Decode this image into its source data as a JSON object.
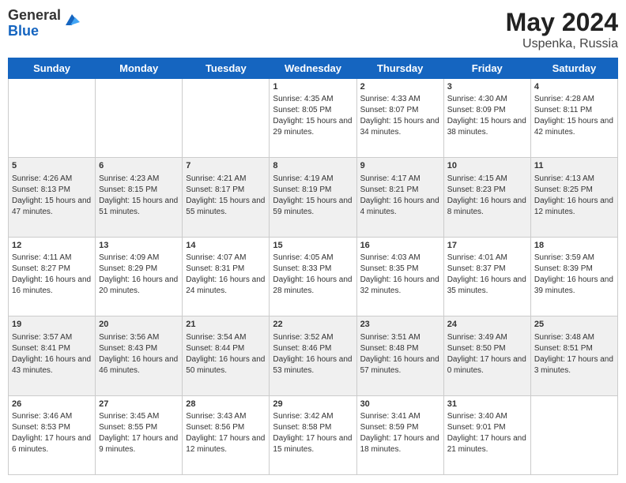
{
  "logo": {
    "general": "General",
    "blue": "Blue"
  },
  "title": {
    "month": "May 2024",
    "location": "Uspenka, Russia"
  },
  "days_of_week": [
    "Sunday",
    "Monday",
    "Tuesday",
    "Wednesday",
    "Thursday",
    "Friday",
    "Saturday"
  ],
  "weeks": [
    [
      {
        "day": "",
        "sunrise": "",
        "sunset": "",
        "daylight": ""
      },
      {
        "day": "",
        "sunrise": "",
        "sunset": "",
        "daylight": ""
      },
      {
        "day": "",
        "sunrise": "",
        "sunset": "",
        "daylight": ""
      },
      {
        "day": "1",
        "sunrise": "Sunrise: 4:35 AM",
        "sunset": "Sunset: 8:05 PM",
        "daylight": "Daylight: 15 hours and 29 minutes."
      },
      {
        "day": "2",
        "sunrise": "Sunrise: 4:33 AM",
        "sunset": "Sunset: 8:07 PM",
        "daylight": "Daylight: 15 hours and 34 minutes."
      },
      {
        "day": "3",
        "sunrise": "Sunrise: 4:30 AM",
        "sunset": "Sunset: 8:09 PM",
        "daylight": "Daylight: 15 hours and 38 minutes."
      },
      {
        "day": "4",
        "sunrise": "Sunrise: 4:28 AM",
        "sunset": "Sunset: 8:11 PM",
        "daylight": "Daylight: 15 hours and 42 minutes."
      }
    ],
    [
      {
        "day": "5",
        "sunrise": "Sunrise: 4:26 AM",
        "sunset": "Sunset: 8:13 PM",
        "daylight": "Daylight: 15 hours and 47 minutes."
      },
      {
        "day": "6",
        "sunrise": "Sunrise: 4:23 AM",
        "sunset": "Sunset: 8:15 PM",
        "daylight": "Daylight: 15 hours and 51 minutes."
      },
      {
        "day": "7",
        "sunrise": "Sunrise: 4:21 AM",
        "sunset": "Sunset: 8:17 PM",
        "daylight": "Daylight: 15 hours and 55 minutes."
      },
      {
        "day": "8",
        "sunrise": "Sunrise: 4:19 AM",
        "sunset": "Sunset: 8:19 PM",
        "daylight": "Daylight: 15 hours and 59 minutes."
      },
      {
        "day": "9",
        "sunrise": "Sunrise: 4:17 AM",
        "sunset": "Sunset: 8:21 PM",
        "daylight": "Daylight: 16 hours and 4 minutes."
      },
      {
        "day": "10",
        "sunrise": "Sunrise: 4:15 AM",
        "sunset": "Sunset: 8:23 PM",
        "daylight": "Daylight: 16 hours and 8 minutes."
      },
      {
        "day": "11",
        "sunrise": "Sunrise: 4:13 AM",
        "sunset": "Sunset: 8:25 PM",
        "daylight": "Daylight: 16 hours and 12 minutes."
      }
    ],
    [
      {
        "day": "12",
        "sunrise": "Sunrise: 4:11 AM",
        "sunset": "Sunset: 8:27 PM",
        "daylight": "Daylight: 16 hours and 16 minutes."
      },
      {
        "day": "13",
        "sunrise": "Sunrise: 4:09 AM",
        "sunset": "Sunset: 8:29 PM",
        "daylight": "Daylight: 16 hours and 20 minutes."
      },
      {
        "day": "14",
        "sunrise": "Sunrise: 4:07 AM",
        "sunset": "Sunset: 8:31 PM",
        "daylight": "Daylight: 16 hours and 24 minutes."
      },
      {
        "day": "15",
        "sunrise": "Sunrise: 4:05 AM",
        "sunset": "Sunset: 8:33 PM",
        "daylight": "Daylight: 16 hours and 28 minutes."
      },
      {
        "day": "16",
        "sunrise": "Sunrise: 4:03 AM",
        "sunset": "Sunset: 8:35 PM",
        "daylight": "Daylight: 16 hours and 32 minutes."
      },
      {
        "day": "17",
        "sunrise": "Sunrise: 4:01 AM",
        "sunset": "Sunset: 8:37 PM",
        "daylight": "Daylight: 16 hours and 35 minutes."
      },
      {
        "day": "18",
        "sunrise": "Sunrise: 3:59 AM",
        "sunset": "Sunset: 8:39 PM",
        "daylight": "Daylight: 16 hours and 39 minutes."
      }
    ],
    [
      {
        "day": "19",
        "sunrise": "Sunrise: 3:57 AM",
        "sunset": "Sunset: 8:41 PM",
        "daylight": "Daylight: 16 hours and 43 minutes."
      },
      {
        "day": "20",
        "sunrise": "Sunrise: 3:56 AM",
        "sunset": "Sunset: 8:43 PM",
        "daylight": "Daylight: 16 hours and 46 minutes."
      },
      {
        "day": "21",
        "sunrise": "Sunrise: 3:54 AM",
        "sunset": "Sunset: 8:44 PM",
        "daylight": "Daylight: 16 hours and 50 minutes."
      },
      {
        "day": "22",
        "sunrise": "Sunrise: 3:52 AM",
        "sunset": "Sunset: 8:46 PM",
        "daylight": "Daylight: 16 hours and 53 minutes."
      },
      {
        "day": "23",
        "sunrise": "Sunrise: 3:51 AM",
        "sunset": "Sunset: 8:48 PM",
        "daylight": "Daylight: 16 hours and 57 minutes."
      },
      {
        "day": "24",
        "sunrise": "Sunrise: 3:49 AM",
        "sunset": "Sunset: 8:50 PM",
        "daylight": "Daylight: 17 hours and 0 minutes."
      },
      {
        "day": "25",
        "sunrise": "Sunrise: 3:48 AM",
        "sunset": "Sunset: 8:51 PM",
        "daylight": "Daylight: 17 hours and 3 minutes."
      }
    ],
    [
      {
        "day": "26",
        "sunrise": "Sunrise: 3:46 AM",
        "sunset": "Sunset: 8:53 PM",
        "daylight": "Daylight: 17 hours and 6 minutes."
      },
      {
        "day": "27",
        "sunrise": "Sunrise: 3:45 AM",
        "sunset": "Sunset: 8:55 PM",
        "daylight": "Daylight: 17 hours and 9 minutes."
      },
      {
        "day": "28",
        "sunrise": "Sunrise: 3:43 AM",
        "sunset": "Sunset: 8:56 PM",
        "daylight": "Daylight: 17 hours and 12 minutes."
      },
      {
        "day": "29",
        "sunrise": "Sunrise: 3:42 AM",
        "sunset": "Sunset: 8:58 PM",
        "daylight": "Daylight: 17 hours and 15 minutes."
      },
      {
        "day": "30",
        "sunrise": "Sunrise: 3:41 AM",
        "sunset": "Sunset: 8:59 PM",
        "daylight": "Daylight: 17 hours and 18 minutes."
      },
      {
        "day": "31",
        "sunrise": "Sunrise: 3:40 AM",
        "sunset": "Sunset: 9:01 PM",
        "daylight": "Daylight: 17 hours and 21 minutes."
      },
      {
        "day": "",
        "sunrise": "",
        "sunset": "",
        "daylight": ""
      }
    ]
  ]
}
